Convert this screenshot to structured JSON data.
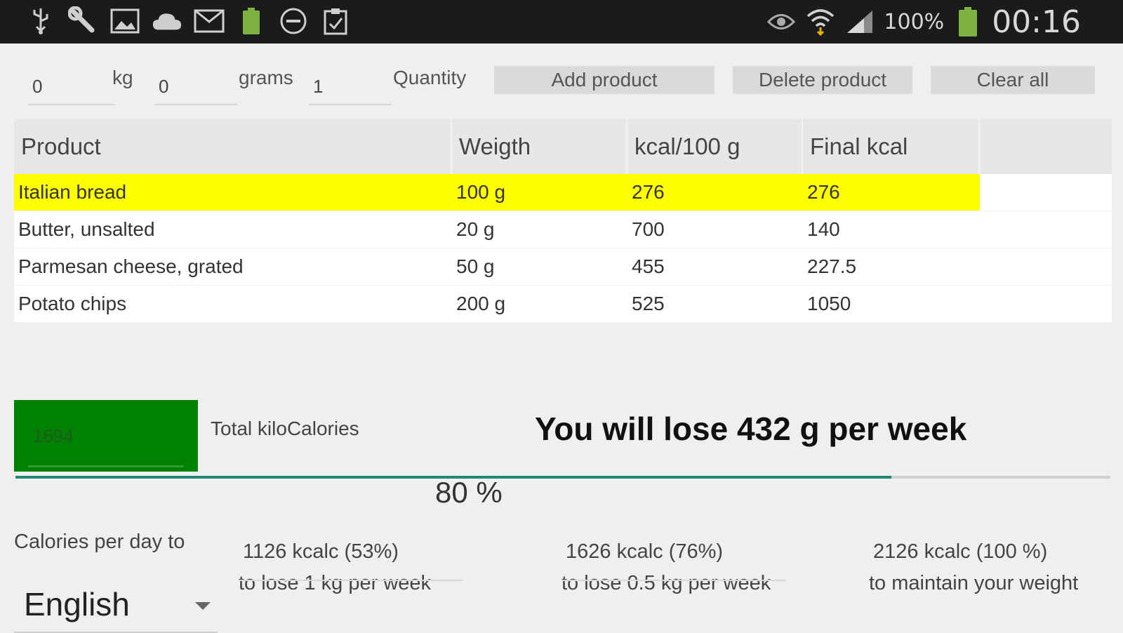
{
  "status_bar": {
    "battery_pct": "100%",
    "time": "00:16",
    "left_icons": [
      "usb-icon",
      "wrench-icon",
      "image-icon",
      "cloud-icon",
      "mail-icon",
      "battery-small-icon",
      "minus-circle-icon",
      "clipboard-icon"
    ],
    "right_icons": [
      "eye-icon",
      "wifi-icon",
      "signal-icon",
      "battery-icon"
    ]
  },
  "input_row": {
    "kg_value": "0",
    "kg_label": "kg",
    "grams_value": "0",
    "grams_label": "grams",
    "quantity_value": "1",
    "quantity_label": "Quantity",
    "add_label": "Add product",
    "delete_label": "Delete product",
    "clear_label": "Clear all"
  },
  "table": {
    "headers": [
      "Product",
      "Weigth",
      "kcal/100 g",
      "Final kcal"
    ],
    "rows": [
      {
        "product": "Italian bread",
        "weight": "100 g",
        "kcal100": "276",
        "final": "276"
      },
      {
        "product": "Butter, unsalted",
        "weight": "20 g",
        "kcal100": "700",
        "final": "140"
      },
      {
        "product": "Parmesan cheese, grated",
        "weight": "50 g",
        "kcal100": "455",
        "final": "227.5"
      },
      {
        "product": "Potato chips",
        "weight": "200 g",
        "kcal100": "525",
        "final": "1050"
      }
    ]
  },
  "totals": {
    "total_kcal": "1694",
    "total_label": "Total kiloCalories",
    "lose_message": "You will lose 432 g per week",
    "progress_pct_text": "80 %",
    "progress_fraction": 0.8
  },
  "calories": {
    "label": "Calories per day to",
    "options": [
      {
        "kcal": "1126 kcalc (53%)",
        "goal": "to lose 1 kg per week"
      },
      {
        "kcal": "1626 kcalc (76%)",
        "goal": "to lose 0.5 kg per week"
      },
      {
        "kcal": "2126 kcalc (100 %)",
        "goal": "to maintain your weight"
      }
    ]
  },
  "language": {
    "selected": "English"
  },
  "colors": {
    "selected_row": "#ffff00",
    "total_box": "#008000",
    "progress": "#1e8a7a",
    "battery_green": "#7cb342"
  }
}
